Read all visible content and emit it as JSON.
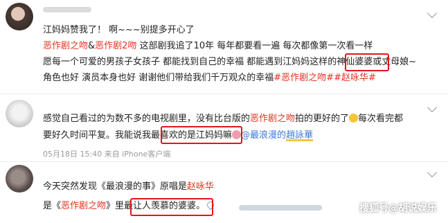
{
  "comments": [
    {
      "lines": [
        {
          "parts": [
            "江妈妈赞我了！ 啊~~~别提多开心了"
          ]
        },
        {
          "parts": [
            "恶作剧之吻",
            "&",
            "恶作剧2吻",
            " 这部剧我追了10年 每年都要看一遍 每次都像第一次看一样"
          ]
        },
        {
          "parts": [
            "愿每一个可爱的男孩子女孩子 都能找到自己的幸福 都能遇到江妈妈这样的",
            "神仙婆婆",
            "或丈母娘~"
          ]
        },
        {
          "parts": [
            "角色也好 演员本身也好 谢谢他们带给我们千万观众的幸福",
            "#恶作剧之吻#",
            "#赵咏华#"
          ]
        }
      ]
    },
    {
      "lines": [
        {
          "parts": [
            "感觉自己看过的为数不多的电视剧里，没有比台版的",
            "恶作剧之吻",
            "拍的更好的了",
            "每次看完都"
          ]
        },
        {
          "parts": [
            "要好久时间平复。我能说我",
            "最喜欢的是江妈妈",
            "嘛",
            "@最浪漫的",
            "趙詠華"
          ]
        }
      ],
      "meta": "05月18日 15:40 来自 iPhone客户端"
    },
    {
      "lines": [
        {
          "parts": [
            "今天突然发现《最浪漫的事》原唱是",
            "赵咏华"
          ]
        },
        {
          "parts": [
            "是《",
            "恶作剧之吻",
            "》里",
            "最让人羡慕的婆婆",
            "。"
          ]
        }
      ]
    }
  ],
  "watermark": "搜狐号@胡说娱乐",
  "colors": {
    "highlight_box": "#e4141c",
    "hashtag_red": "#e0331f",
    "link_blue": "#3d7bd6"
  }
}
